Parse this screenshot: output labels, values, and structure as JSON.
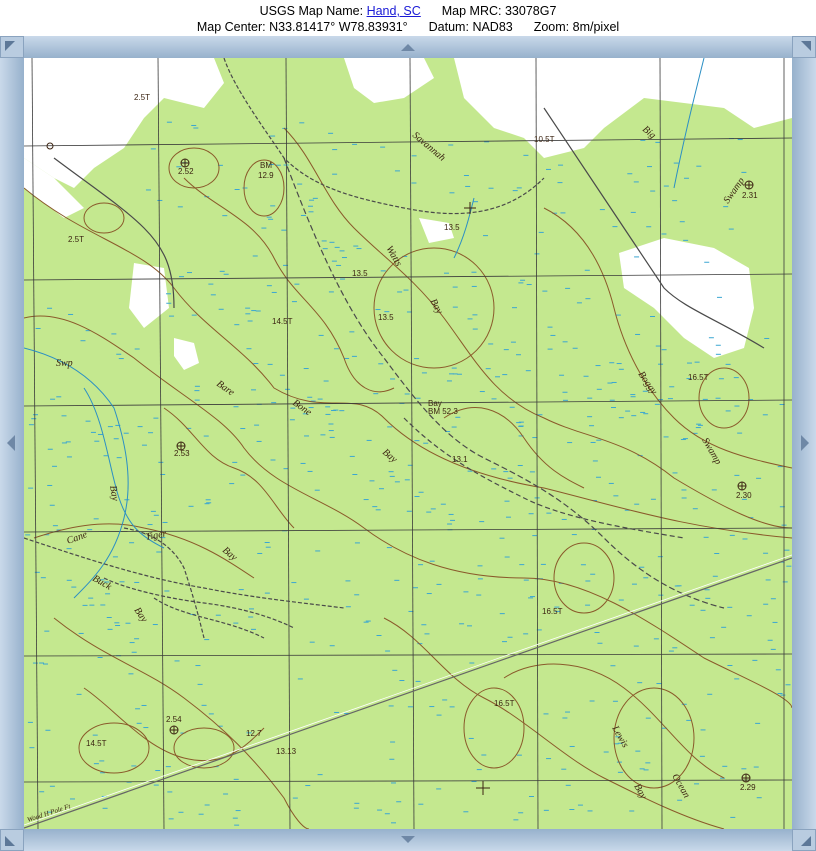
{
  "header": {
    "map_name_label": "USGS Map Name:",
    "map_name_link": "Hand, SC",
    "mrc_label": "Map MRC:",
    "mrc_value": "33078G7",
    "center_label": "Map Center:",
    "center_lat": "N33.81417°",
    "center_lon": "W78.83931°",
    "datum_label": "Datum:",
    "datum_value": "NAD83",
    "zoom_label": "Zoom:",
    "zoom_value": "8m/pixel"
  },
  "map_labels": {
    "savannah": "Savannah",
    "big": "Big",
    "swamp_top": "Swamp",
    "watts": "Watts",
    "bay_watts": "Bay",
    "bare": "Bare",
    "bone": "Bone",
    "bay_bone": "Bay",
    "boggy": "Boggy",
    "swamp_right": "Swamp",
    "swp": "Swp",
    "bay_left": "Bay",
    "cane": "Cane",
    "tiger": "Tiger",
    "bay_tiger": "Bay",
    "buck": "Buck",
    "bay_buck": "Bay",
    "lewis": "Lewis",
    "bay_lewis": "Bay",
    "ocean": "Ocean",
    "powerline": "Wood H Pole Ft",
    "bm_center": "BM 52.3",
    "bay_bm": "Bay",
    "bm_top": "BM",
    "bm_top_val": "12.9",
    "elev_1457a": "14.5T",
    "elev_1457b": "14.5T",
    "elev_165": "16.5T",
    "elev_165b": "16.5T",
    "elev_165c": "16.5T",
    "elev_135": "13.5",
    "elev_135b": "13.5",
    "elev_135c": "13.5",
    "elev_131": "13.1",
    "elev_252": "2.52",
    "elev_257": "2.5T",
    "elev_257b": "2.5T",
    "elev_253": "2.53",
    "elev_254": "2.54",
    "elev_1057": "10.5T",
    "elev_231": "2.31",
    "elev_230": "2.30",
    "elev_229": "2.29",
    "elev_127": "12.7",
    "elev_1313": "13.13"
  },
  "colors": {
    "land": "#c4e88f",
    "clearing": "#ffffff",
    "marsh": "#3aa6d2",
    "contour": "#8a5a2b",
    "grid": "#3a3a3a",
    "road": "#4a4a4a"
  }
}
